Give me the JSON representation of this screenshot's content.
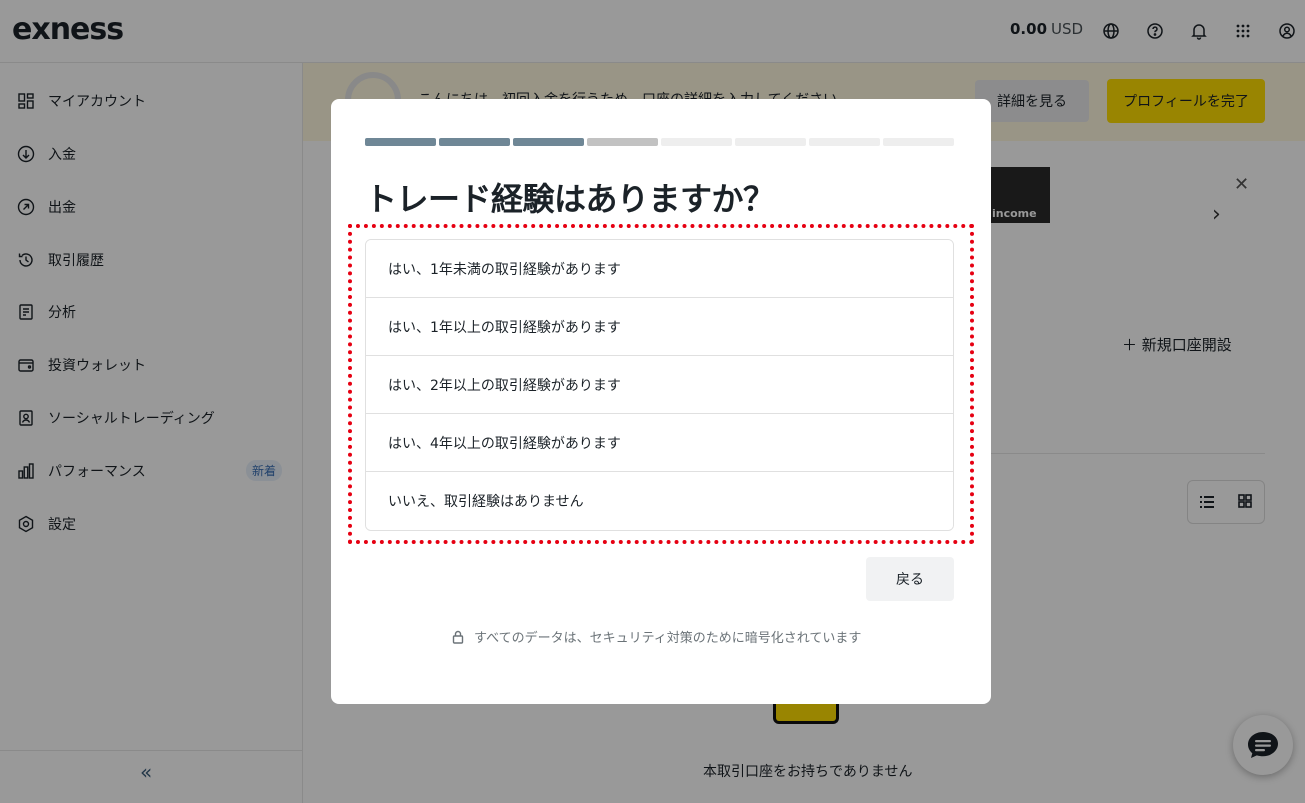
{
  "header": {
    "logo": "exness",
    "balance_amount": "0.00",
    "balance_currency": "USD"
  },
  "sidebar": {
    "items": [
      {
        "label": "マイアカウント",
        "icon": "grid-icon"
      },
      {
        "label": "入金",
        "icon": "arrow-down-circle-icon"
      },
      {
        "label": "出金",
        "icon": "arrow-up-right-circle-icon"
      },
      {
        "label": "取引履歴",
        "icon": "history-icon"
      },
      {
        "label": "分析",
        "icon": "analysis-icon"
      },
      {
        "label": "投資ウォレット",
        "icon": "wallet-icon"
      },
      {
        "label": "ソーシャルトレーディング",
        "icon": "social-trading-icon"
      },
      {
        "label": "パフォーマンス",
        "icon": "bar-chart-icon"
      },
      {
        "label": "設定",
        "icon": "settings-icon"
      }
    ],
    "performance_badge": "新着",
    "collapse": "«"
  },
  "banner": {
    "text": "こんにちは。初回入金を行うため、口座の詳細を入力してください",
    "detail_button": "詳細を見る",
    "profile_button": "プロフィールを完了"
  },
  "main": {
    "promo_label": "income",
    "new_account": "新規口座開設",
    "no_account": "本取引口座をお持ちでありません"
  },
  "modal": {
    "progress": {
      "total": 8,
      "completed": 3,
      "current": 4
    },
    "question": "トレード経験はありますか？",
    "options": [
      "はい、1年未満の取引経験があります",
      "はい、1年以上の取引経験があります",
      "はい、2年以上の取引経験があります",
      "はい、4年以上の取引経験があります",
      "いいえ、取引経験はありません"
    ],
    "back_button": "戻る",
    "security_note": "すべてのデータは、セキュリティ対策のために暗号化されています"
  },
  "colors": {
    "accent_yellow": "#ffde02",
    "progress_done": "#6f8796",
    "highlight_red": "#e60012"
  }
}
